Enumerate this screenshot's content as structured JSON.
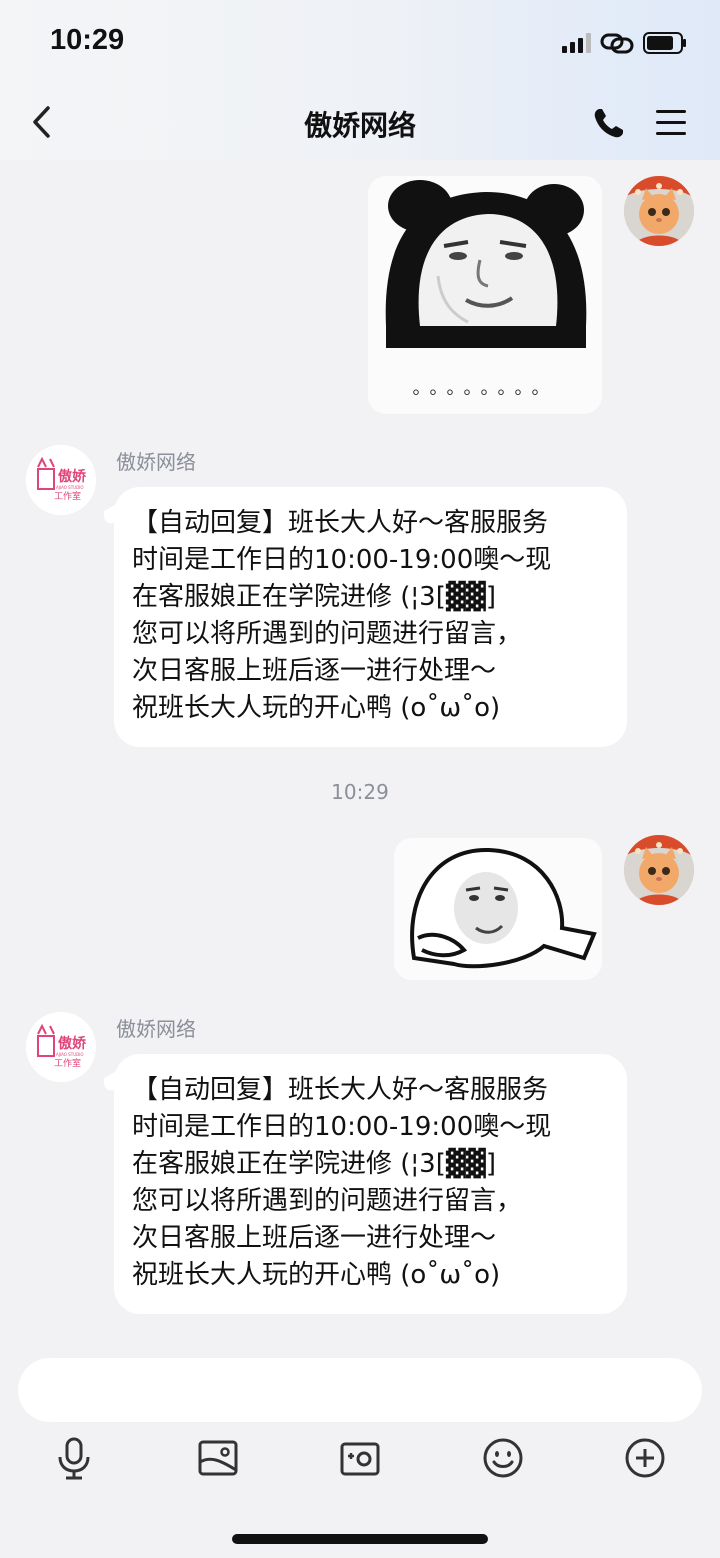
{
  "status_bar": {
    "time": "10:29"
  },
  "header": {
    "title": "傲娇网络"
  },
  "messages": {
    "m1_caption": "。。。。。。。。",
    "m2_sender": "傲娇网络",
    "m2_text": "【自动回复】班长大人好～客服服务\n时间是工作日的10:00-19:00噢～现\n在客服娘正在学院进修 (¦3[▓▓]\n您可以将所遇到的问题进行留言，\n次日客服上班后逐一进行处理～\n祝班长大人玩的开心鸭 (o˚ω˚o)",
    "timestamp": "10:29",
    "m4_sender": "傲娇网络",
    "m4_text": "【自动回复】班长大人好～客服服务\n时间是工作日的10:00-19:00噢～现\n在客服娘正在学院进修 (¦3[▓▓]\n您可以将所遇到的问题进行留言，\n次日客服上班后逐一进行处理～\n祝班长大人玩的开心鸭 (o˚ω˚o)",
    "logo_line1": "傲娇",
    "logo_line2": "工作室",
    "logo_small": "AJIAO STUDIO"
  },
  "input": {
    "placeholder": ""
  },
  "icons": {
    "back": "chevron-left-icon",
    "phone": "phone-icon",
    "menu": "hamburger-menu-icon",
    "voice": "microphone-icon",
    "image": "image-icon",
    "camera": "camera-icon",
    "emoji": "emoji-icon",
    "more": "plus-circle-icon"
  },
  "colors": {
    "background": "#f2f2f4",
    "bubble": "#ffffff",
    "muted_text": "#8a8f99",
    "logo_pink": "#e0457a"
  }
}
